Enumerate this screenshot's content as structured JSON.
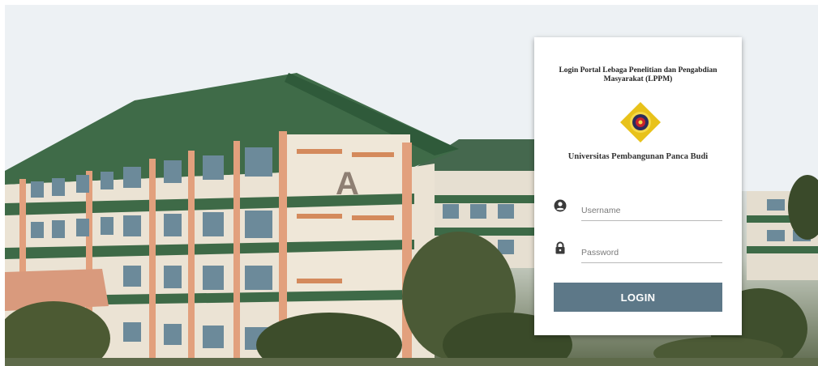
{
  "login_card": {
    "title": "Login Portal Lebaga Penelitian dan Pengabdian Masyarakat (LPPM)",
    "university_name": "Universitas Pembangunan Panca Budi",
    "username": {
      "placeholder": "Username",
      "value": "",
      "icon": "user-circle-icon"
    },
    "password": {
      "placeholder": "Password",
      "value": "",
      "icon": "lock-icon"
    },
    "login_button_label": "LOGIN"
  },
  "background": {
    "building_sign": "A"
  },
  "colors": {
    "button": "#5d7888",
    "roof": "#3f6e49",
    "wall": "#ece4d6",
    "trim": "#e2a07d",
    "logo_yellow": "#e8c21a",
    "logo_red": "#c8232b"
  }
}
